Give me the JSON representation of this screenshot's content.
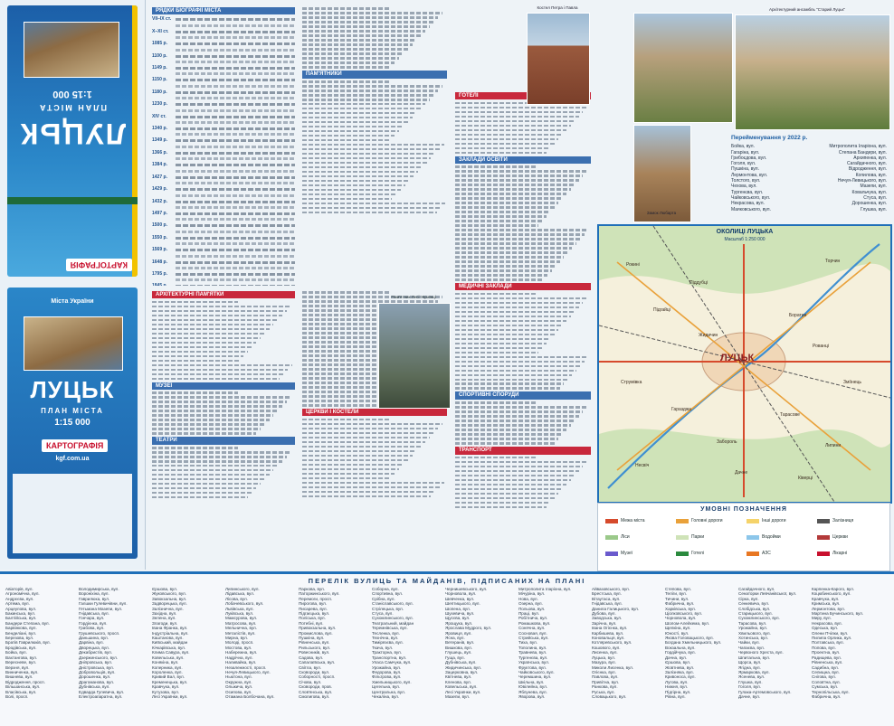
{
  "cover_top": {
    "title": "ЛУЦЬК",
    "subtitle": "ПЛАН МІСТА",
    "scale": "1:15 000",
    "publisher": "КАРТОГРАФІЯ"
  },
  "cover_bottom": {
    "title": "ЛУЦЬК",
    "subtitle": "ПЛАН МІСТА",
    "scale": "1:15 000",
    "publisher": "КАРТОГРАФІЯ",
    "site": "kgf.com.ua",
    "brand": "Міста України"
  },
  "history": {
    "heading": "РЯДКИ БІОГРАФІЇ МІСТА",
    "years": [
      "VII–IX ст.",
      "X–XI ст.",
      "1085 р.",
      "1100 р.",
      "1149 р.",
      "1150 р.",
      "1180 р.",
      "1230 р.",
      "XIV ст.",
      "1340 р.",
      "1349 р.",
      "1366 р.",
      "1384 р.",
      "1427 р.",
      "1429 р.",
      "1432 р.",
      "1497 р.",
      "1500 р.",
      "1550 р.",
      "1569 р.",
      "1648 р.",
      "1795 р.",
      "1845 р.",
      "1850 р.",
      "1870 р.",
      "1890 р.",
      "1915 р.",
      "1919 р.",
      "1939 р.",
      "1941 р.",
      "1944 р.",
      "1991 р."
    ]
  },
  "section_headings": {
    "a": "АРХІТЕКТУРНІ ПАМ'ЯТКИ",
    "b": "МУЗЕЇ",
    "c": "ТЕАТРИ",
    "d": "ПАМ'ЯТНИКИ",
    "e": "ЦЕРКВИ І КОСТЕЛИ",
    "f": "ГОТЕЛІ",
    "g": "ЗАКЛАДИ ОСВІТИ",
    "h": "МЕДИЧНІ ЗАКЛАДИ",
    "i": "СПОРТИВНІ СПОРУДИ",
    "j": "ТРАНСПОРТ"
  },
  "photos": {
    "cathedral_caption": "Костел Петра і Павла",
    "castle_caption": "Замок Любарта",
    "aerial_caption": "Архітектурний ансамбль \"Старий Луцьк\"",
    "monument_caption": "Пам'ятник Лесі Українці"
  },
  "renamed": {
    "title": "Перейменування у 2022 р.",
    "rows": [
      [
        "Бойка, вул.",
        "Митрополита Іларіона, вул."
      ],
      [
        "Гагаріна, вул.",
        "Степана Бандери, вул."
      ],
      [
        "Грибоєдова, вул.",
        "Архипенка, вул."
      ],
      [
        "Гоголя, вул.",
        "Сагайдачного, вул."
      ],
      [
        "Пушкіна, вул.",
        "Відродження, вул."
      ],
      [
        "Лермонтова, вул.",
        "Копилова, вул."
      ],
      [
        "Толстого, вул.",
        "Нечуя-Левицького, вул."
      ],
      [
        "Чехова, вул.",
        "Мазепи, вул."
      ],
      [
        "Тургенєва, вул.",
        "Ковальчука, вул."
      ],
      [
        "Чайковського, вул.",
        "Стуса, вул."
      ],
      [
        "Некрасова, вул.",
        "Дорошенка, вул."
      ],
      [
        "Маяковського, вул.",
        "Глушка, вул."
      ]
    ]
  },
  "inset": {
    "title": "ОКОЛИЦІ ЛУЦЬКА",
    "scale": "Масштаб 1:250 000",
    "city_label": "ЛУЦЬК",
    "places": [
      "Рокині",
      "Торчин",
      "Підгайці",
      "Боратин",
      "Жидичин",
      "Рованці",
      "Струмівка",
      "Зміїнець",
      "Гаразджа",
      "Тарасове",
      "Забороль",
      "Липини",
      "Несвіч",
      "Дачне",
      "Ківерці",
      "Піддубці"
    ]
  },
  "legend": {
    "title": "УМОВНІ ПОЗНАЧЕННЯ",
    "items": [
      "Межа міста",
      "Головні дороги",
      "Інші дороги",
      "Залізниця",
      "Ліси",
      "Парки",
      "Водойми",
      "Церкви",
      "Музеї",
      "Готелі",
      "АЗС",
      "Лікарні"
    ]
  },
  "index": {
    "title": "ПЕРЕЛІК ВУЛИЦЬ ТА МАЙДАНІВ, ПІДПИСАНИХ НА ПЛАНІ",
    "columns": [
      [
        "Авіаторів, вул.",
        "Агрономічна, вул.",
        "Андрєєва, вул.",
        "Артема, вул.",
        "Арцеулова, вул.",
        "Бакинська, вул.",
        "Балтійська, вул.",
        "Бандери Степана, вул.",
        "Барвінкова, вул.",
        "Бенделіані, вул.",
        "Березова, вул.",
        "Братів Гаврилюків, вул.",
        "Бродівська, вул.",
        "Бойка, вул.",
        "Вахтангова, вул.",
        "Вересневе, вул.",
        "Верхня, вул.",
        "Винниченка, вул.",
        "Вишнева, вул.",
        "Відродження, просп.",
        "Вільшанська, вул.",
        "Власівська, вул.",
        "Волі, просп."
      ],
      [
        "Володимирська, вул.",
        "Вороніхіна, вул.",
        "Гаврилюка, вул.",
        "Галшки Гулевичівни, вул.",
        "Гетьмана Мазепи, вул.",
        "Гнідавська, вул.",
        "Гончара, вул.",
        "Гордієнка, вул.",
        "Грабова, вул.",
        "Грушевського, просп.",
        "Даньшина, вул.",
        "Дарвіна, вул.",
        "Дворецька, вул.",
        "Декабристів, вул.",
        "Дзержинського, вул.",
        "Дніпровська, вул.",
        "Дністровська, вул.",
        "Добровольців, вул.",
        "Дорошенка, вул.",
        "Драгоманова, вул.",
        "Дубнівська, вул.",
        "Едварда Гулевича, вул.",
        "Електроапаратна, вул."
      ],
      [
        "Єршова, вул.",
        "Жуковського, вул.",
        "Завокзальна, вул.",
        "Задворецька, вул.",
        "Залізнична, вул.",
        "Західна, вул.",
        "Зелена, вул.",
        "Злагоди, вул.",
        "Івана Франка, вул.",
        "Індустріальна, вул.",
        "Каштанова, вул.",
        "Київський, майдан",
        "Кічкарівська, вул.",
        "Клима Савура, вул.",
        "Ковельська, вул.",
        "Конякіна, вул.",
        "Коперника, вул.",
        "Короленка, вул.",
        "Кривий Вал, вул.",
        "Кременецька, вул.",
        "Кравчука, вул.",
        "Кутузова, вул.",
        "Лесі Українки, вул."
      ],
      [
        "Липинського, вул.",
        "Лідавська, вул.",
        "Лісова, вул.",
        "Лобачевського, вул.",
        "Львівська, вул.",
        "Луківська, вул.",
        "Мамсурова, вул.",
        "Матросова, вул.",
        "Мельнична, вул.",
        "Металістів, вул.",
        "Мирна, вул.",
        "Молоді, просп.",
        "Мостова, вул.",
        "Набережна, вул.",
        "Надрічна, вул.",
        "Наливайка, вул.",
        "Незалежності, просп.",
        "Нечуя-Левицького, вул.",
        "Ньютона, вул.",
        "Окружна, вул.",
        "Ольжича, вул.",
        "Осипова, вул.",
        "Отамана Болбочана, вул."
      ],
      [
        "Паркова, вул.",
        "Паторжинського, вул.",
        "Перемоги, просп.",
        "Пирогова, вул.",
        "Писарева, вул.",
        "Підгаєцька, вул.",
        "Поліська, вул.",
        "Потебні, вул.",
        "Привокзальна, вул.",
        "Промислова, вул.",
        "Пушкіна, вул.",
        "Рівненська, вул.",
        "Рильського, вул.",
        "Ровесників, вул.",
        "Садова, вул.",
        "Сапалаївська, вул.",
        "Світла, вул.",
        "Сковороди, вул.",
        "Соборності, просп.",
        "Січова, вул.",
        "Сковороди, пров.",
        "Слов'янська, вул.",
        "Смолигова, вул."
      ],
      [
        "Соборна, вул.",
        "Спортивна, вул.",
        "Срібна, вул.",
        "Станіславського, вул.",
        "Стрілецька, вул.",
        "Стуса, вул.",
        "Сухомлинського, вул.",
        "Театральний, майдан",
        "Теремнівська, вул.",
        "Тесленка, вул.",
        "Технічна, вул.",
        "Тимірязєва, вул.",
        "Ткача, вул.",
        "Тракторна, вул.",
        "Транспортна, вул.",
        "Уласа Самчука, вул.",
        "Урожайна, вул.",
        "Федорова, вул.",
        "Фільтрова, вул.",
        "Хмельницького, вул.",
        "Цегельна, вул.",
        "Центральна, вул.",
        "Чекаліна, вул."
      ],
      [
        "Чернишевського, вул.",
        "Чорновола, вул.",
        "Шевченка, вул.",
        "Шептицького, вул.",
        "Шопена, вул.",
        "Шухевича, вул.",
        "Щусєва, вул.",
        "Ярощука, вул.",
        "Ярослава Мудрого, вул.",
        "Яровиця, вул.",
        "Ясна, вул.",
        "Ветеранів, вул.",
        "Вишкова, вул.",
        "Глушець, вул.",
        "Гуща, вул.",
        "Дубнівська, вул.",
        "Жидичинська, вул.",
        "Зацерковна, вул.",
        "Квітнева, вул.",
        "Кленова, вул.",
        "Ковельська, вул.",
        "Лесі Українки, вул.",
        "Мазепи, вул."
      ],
      [
        "Митрополита Іларіона, вул.",
        "Мічуріна, вул.",
        "Нова, вул.",
        "Озерна, вул.",
        "Польова, вул.",
        "Праці, вул.",
        "Робітнича, вул.",
        "Ромашкова, вул.",
        "Сонячна, вул.",
        "Сосновая, вул.",
        "Стрийська, вул.",
        "Тиха, вул.",
        "Тополина, вул.",
        "Травнева, вул.",
        "Тургенєва, вул.",
        "Українська, вул.",
        "Фруктова, вул.",
        "Чайковського, вул.",
        "Черемшина, вул.",
        "Шкільна, вул.",
        "Ювілейна, вул.",
        "Яблунева, вул.",
        "Яворова, вул."
      ],
      [
        "Айвазовського, вул.",
        "Брестська, вул.",
        "Вітаутаса, вул.",
        "Гнідавська, вул.",
        "Данила Галицького, вул.",
        "Дубова, вул.",
        "Заводська, вул.",
        "Зарічна, вул.",
        "Івана Огієнка, вул.",
        "Карбишева, вул.",
        "Коновальця, вул.",
        "Котляревського, вул.",
        "Кошового, вул.",
        "Лисенка, вул.",
        "Луцька, вул.",
        "Мазура, вул.",
        "Миколи Лисенка, вул.",
        "Огієнка, вул.",
        "Павлова, вул.",
        "Привітна, вул.",
        "Ранкова, вул.",
        "Руська, вул.",
        "Словацького, вул."
      ],
      [
        "Степова, вул.",
        "Теліги, вул.",
        "Тичини, вул.",
        "Фабрична, вул.",
        "Харківська, вул.",
        "Ціолковського, вул.",
        "Чорновола, вул.",
        "Шолом-Алейхема, вул.",
        "Щепкіна, вул.",
        "Юності, вул.",
        "Якова Головацького, вул.",
        "Богдана Хмельницького, вул.",
        "Вокзальна, вул.",
        "Гордійчука, вул.",
        "Дачна, вул.",
        "Єршова, вул.",
        "Жовтнева, вул.",
        "Залізняка, вул.",
        "Кривоноса, вул.",
        "Лугова, вул.",
        "Нижня, вул.",
        "Підгірна, вул.",
        "Рівна, вул."
      ],
      [
        "Сагайдачного, вул.",
        "Сенаторки Левчанівської, вул.",
        "Сірка, вул.",
        "Сенкевича, вул.",
        "Слобідська, вул.",
        "Старицького, вул.",
        "Сухомлинського, вул.",
        "Тарасова, вул.",
        "Урожайна, вул.",
        "Хвильового, вул.",
        "Хотинська, вул.",
        "Чайки, вул.",
        "Чапаєва, вул.",
        "Червоного Хреста, вул.",
        "Шпитальна, вул.",
        "Щорса, вул.",
        "Ягідна, вул.",
        "Ярмаркова, вул.",
        "Ясенева, вул.",
        "Глушка, вул.",
        "Гоголя, вул.",
        "Гулака-Артемовського, вул.",
        "Дачне, вул."
      ],
      [
        "Карпенка-Карого, вул.",
        "Коцюбинського, вул.",
        "Кравчука, вул.",
        "Кримська, вул.",
        "Лермонтова, вул.",
        "Мартина Бучинського, вул.",
        "Миру, вул.",
        "Некрасова, вул.",
        "Одеська, вул.",
        "Олени Пчілки, вул.",
        "Пилипа Орлика, вул.",
        "Полтавська, вул.",
        "Попова, вул.",
        "Проектна, вул.",
        "Радищева, вул.",
        "Рівненська, вул.",
        "Садибна, вул.",
        "Селищна, вул.",
        "Снігова, вул.",
        "Солов'їна, вул.",
        "Сумська, вул.",
        "Тернопільська, вул.",
        "Фабрична, вул."
      ]
    ]
  }
}
